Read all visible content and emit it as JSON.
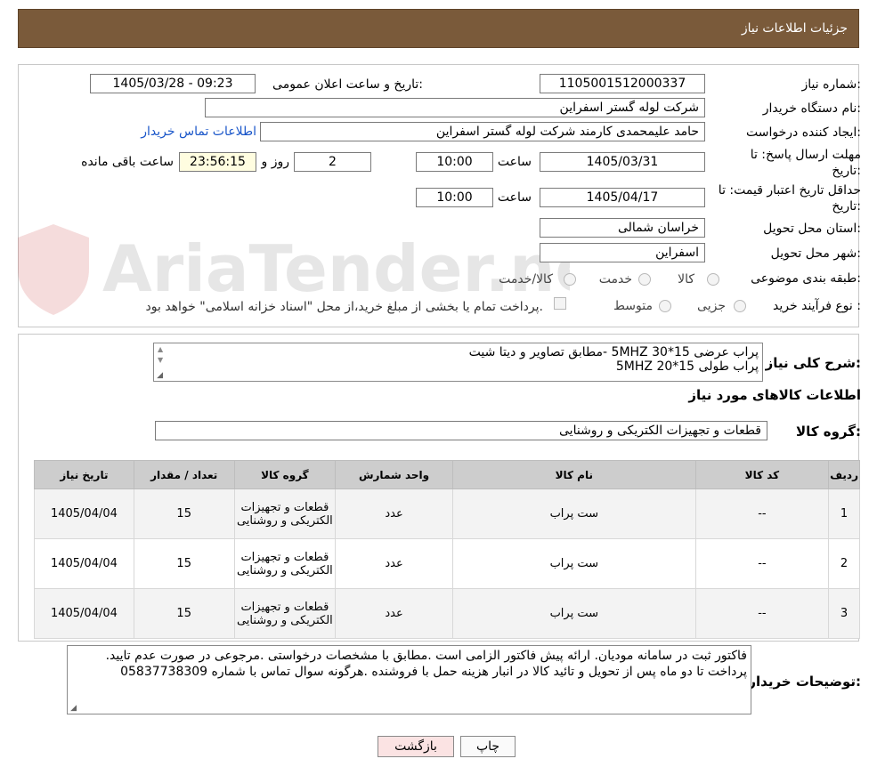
{
  "header": {
    "title": "جزئیات اطلاعات نیاز"
  },
  "form": {
    "need_number_label": "شماره نیاز:",
    "need_number": "1105001512000337",
    "announce_label": "تاریخ و ساعت اعلان عمومی:",
    "announce_value": "1405/03/28 - 09:23",
    "buyer_org_label": "نام دستگاه خریدار:",
    "buyer_org": "شرکت لوله گستر اسفراین",
    "creator_label": "ایجاد کننده درخواست:",
    "creator": "حامد علیمحمدی کارمند شرکت لوله گستر اسفراین",
    "contact_link": "اطلاعات تماس خریدار",
    "reply_deadline_label_1": "مهلت ارسال پاسخ: تا",
    "reply_deadline_label_2": "تاریخ:",
    "reply_date": "1405/03/31",
    "time_label": "ساعت",
    "reply_time": "10:00",
    "days": "2",
    "days_label": "روز و",
    "remaining": "23:56:15",
    "remaining_label": "ساعت باقی مانده",
    "price_validity_label_1": "حداقل تاریخ اعتبار قیمت: تا",
    "price_validity_label_2": "تاریخ:",
    "price_date": "1405/04/17",
    "price_time": "10:00",
    "province_label": "استان محل تحویل:",
    "province": "خراسان شمالی",
    "city_label": "شهر محل تحویل:",
    "city": "اسفراین",
    "category_label": "طبقه بندی موضوعی:",
    "category_options": [
      "کالا",
      "خدمت",
      "کالا/خدمت"
    ],
    "process_label": "نوع فرآیند خرید :",
    "process_options": [
      "جزیی",
      "متوسط"
    ],
    "payment_note": "پرداخت تمام یا بخشی از مبلغ خرید،از محل \"اسناد خزانه اسلامی\" خواهد بود."
  },
  "watermark": {
    "text": "AriaTender.neT"
  },
  "description": {
    "label": "شرح کلی نیاز:",
    "line1": "پراب عرضی 15*30 5MHZ -مطابق تصاویر و دیتا شیت",
    "line2": "پراب طولی 15*20 5MHZ"
  },
  "items_section": {
    "title": "اطلاعات کالاهای مورد نیاز",
    "group_label": "گروه کالا:",
    "group_value": "قطعات و تجهیزات الکتریکی و روشنایی"
  },
  "table": {
    "headers": [
      "ردیف",
      "کد کالا",
      "نام کالا",
      "واحد شمارش",
      "گروه کالا",
      "تعداد / مقدار",
      "تاریخ نیاز"
    ],
    "rows": [
      {
        "num": "1",
        "code": "--",
        "name": "ست پراب",
        "unit": "عدد",
        "group": "قطعات و تجهیزات الکتریکی و روشنایی",
        "qty": "15",
        "date": "1405/04/04"
      },
      {
        "num": "2",
        "code": "--",
        "name": "ست پراب",
        "unit": "عدد",
        "group": "قطعات و تجهیزات الکتریکی و روشنایی",
        "qty": "15",
        "date": "1405/04/04"
      },
      {
        "num": "3",
        "code": "--",
        "name": "ست پراب",
        "unit": "عدد",
        "group": "قطعات و تجهیزات الکتریکی و روشنایی",
        "qty": "15",
        "date": "1405/04/04"
      }
    ]
  },
  "buyer_notes": {
    "label": "توضیحات خریدار:",
    "line1": "فاکتور ثبت در سامانه مودیان. ارائه پیش فاکتور الزامی است .مطابق با مشخصات درخواستی .مرجوعی در صورت عدم تایید.",
    "line2": "پرداخت تا دو ماه پس از تحویل و تائید کالا در انبار  هزینه حمل با فروشنده .هرگونه سوال تماس با شماره 05837738309"
  },
  "buttons": {
    "print": "چاپ",
    "back": "بازگشت"
  }
}
